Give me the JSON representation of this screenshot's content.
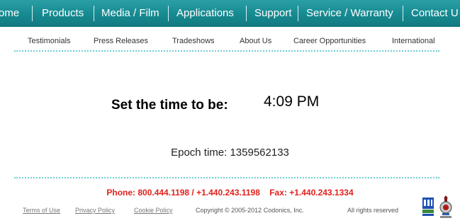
{
  "topnav": {
    "items": [
      "ome",
      "Products",
      "Media / Film",
      "Applications",
      "Support",
      "Service / Warranty",
      "Contact U"
    ]
  },
  "subnav": {
    "items": [
      "Testimonials",
      "Press Releases",
      "Tradeshows",
      "About Us",
      "Career Opportunities",
      "International"
    ]
  },
  "main": {
    "set_time_label": "Set the time to be:",
    "set_time_value": "4:09 PM",
    "epoch_label": "Epoch time: 1359562133"
  },
  "contact": {
    "line": "Phone: 800.444.1198 / +1.440.243.1198    Fax: +1.440.243.1334"
  },
  "footer": {
    "links": [
      "Terms of Use",
      "Privacy Policy",
      "Cookie Policy"
    ],
    "copyright": "Copyright © 2005-2012 Codonics, Inc.",
    "rights": "All rights reserved"
  },
  "colors": {
    "nav_teal": "#168a91",
    "dots": "#6dcdd1",
    "contact_red": "#e0201b"
  },
  "icons": [
    "certification-badge-icon",
    "award-seal-icon"
  ]
}
